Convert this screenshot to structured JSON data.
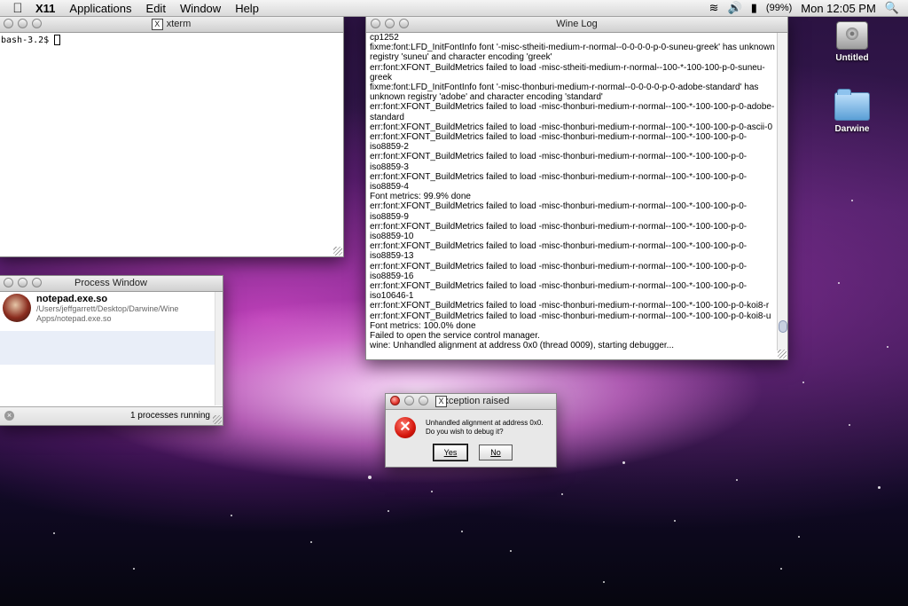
{
  "menubar": {
    "apple_icon": "apple-icon",
    "app_name": "X11",
    "items": [
      "Applications",
      "Edit",
      "Window",
      "Help"
    ],
    "battery": "(99%)",
    "clock": "Mon 12:05 PM"
  },
  "xterm": {
    "title": "xterm",
    "prompt": "bash-3.2$"
  },
  "winelog": {
    "title": "Wine Log",
    "lines": [
      "cp1252",
      "fixme:font:LFD_InitFontInfo font '-misc-stheiti-medium-r-normal--0-0-0-0-p-0-suneu-greek' has unknown registry 'suneu' and character encoding 'greek'",
      "err:font:XFONT_BuildMetrics failed to load -misc-stheiti-medium-r-normal--100-*-100-100-p-0-suneu-greek",
      "fixme:font:LFD_InitFontInfo font '-misc-thonburi-medium-r-normal--0-0-0-0-p-0-adobe-standard' has unknown registry 'adobe' and character encoding 'standard'",
      "err:font:XFONT_BuildMetrics failed to load -misc-thonburi-medium-r-normal--100-*-100-100-p-0-adobe-standard",
      "err:font:XFONT_BuildMetrics failed to load -misc-thonburi-medium-r-normal--100-*-100-100-p-0-ascii-0",
      "err:font:XFONT_BuildMetrics failed to load -misc-thonburi-medium-r-normal--100-*-100-100-p-0-iso8859-2",
      "err:font:XFONT_BuildMetrics failed to load -misc-thonburi-medium-r-normal--100-*-100-100-p-0-iso8859-3",
      "err:font:XFONT_BuildMetrics failed to load -misc-thonburi-medium-r-normal--100-*-100-100-p-0-iso8859-4",
      "Font metrics: 99.9% done",
      "err:font:XFONT_BuildMetrics failed to load -misc-thonburi-medium-r-normal--100-*-100-100-p-0-iso8859-9",
      "err:font:XFONT_BuildMetrics failed to load -misc-thonburi-medium-r-normal--100-*-100-100-p-0-iso8859-10",
      "err:font:XFONT_BuildMetrics failed to load -misc-thonburi-medium-r-normal--100-*-100-100-p-0-iso8859-13",
      "err:font:XFONT_BuildMetrics failed to load -misc-thonburi-medium-r-normal--100-*-100-100-p-0-iso8859-16",
      "err:font:XFONT_BuildMetrics failed to load -misc-thonburi-medium-r-normal--100-*-100-100-p-0-iso10646-1",
      "err:font:XFONT_BuildMetrics failed to load -misc-thonburi-medium-r-normal--100-*-100-100-p-0-koi8-r",
      "err:font:XFONT_BuildMetrics failed to load -misc-thonburi-medium-r-normal--100-*-100-100-p-0-koi8-u",
      "Font metrics: 100.0% done",
      "Failed to open the service control manager.",
      "wine: Unhandled alignment at address 0x0 (thread 0009), starting debugger..."
    ]
  },
  "process": {
    "title": "Process Window",
    "name": "notepad.exe.so",
    "path": "/Users/jeffgarrett/Desktop/Darwine/Wine Apps/notepad.exe.so",
    "status": "1 processes running"
  },
  "exception": {
    "title": "Exception raised",
    "message": "Unhandled alignment at address 0x0. Do you wish to debug it?",
    "yes": "Yes",
    "no": "No"
  },
  "desktop": {
    "icons": [
      {
        "label": "Untitled",
        "icon": "hard-drive-icon"
      },
      {
        "label": "Darwine",
        "icon": "folder-icon"
      }
    ]
  }
}
